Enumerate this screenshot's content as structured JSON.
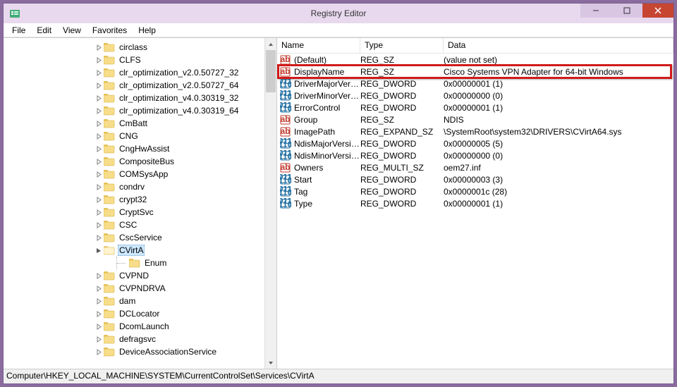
{
  "window": {
    "title": "Registry Editor"
  },
  "menu": {
    "file": "File",
    "edit": "Edit",
    "view": "View",
    "favorites": "Favorites",
    "help": "Help"
  },
  "tree": {
    "items": [
      {
        "label": "circlass",
        "indent": 6
      },
      {
        "label": "CLFS",
        "indent": 6
      },
      {
        "label": "clr_optimization_v2.0.50727_32",
        "indent": 6
      },
      {
        "label": "clr_optimization_v2.0.50727_64",
        "indent": 6
      },
      {
        "label": "clr_optimization_v4.0.30319_32",
        "indent": 6
      },
      {
        "label": "clr_optimization_v4.0.30319_64",
        "indent": 6
      },
      {
        "label": "CmBatt",
        "indent": 6
      },
      {
        "label": "CNG",
        "indent": 6
      },
      {
        "label": "CngHwAssist",
        "indent": 6
      },
      {
        "label": "CompositeBus",
        "indent": 6
      },
      {
        "label": "COMSysApp",
        "indent": 6
      },
      {
        "label": "condrv",
        "indent": 6
      },
      {
        "label": "crypt32",
        "indent": 6
      },
      {
        "label": "CryptSvc",
        "indent": 6
      },
      {
        "label": "CSC",
        "indent": 6
      },
      {
        "label": "CscService",
        "indent": 6
      },
      {
        "label": "CVirtA",
        "indent": 6,
        "selected": true,
        "expanded": true
      },
      {
        "label": "Enum",
        "indent": 7,
        "child": true
      },
      {
        "label": "CVPND",
        "indent": 6
      },
      {
        "label": "CVPNDRVA",
        "indent": 6
      },
      {
        "label": "dam",
        "indent": 6
      },
      {
        "label": "DCLocator",
        "indent": 6
      },
      {
        "label": "DcomLaunch",
        "indent": 6
      },
      {
        "label": "defragsvc",
        "indent": 6
      },
      {
        "label": "DeviceAssociationService",
        "indent": 6
      }
    ]
  },
  "list": {
    "headers": {
      "name": "Name",
      "type": "Type",
      "data": "Data"
    },
    "rows": [
      {
        "icon": "sz",
        "name": "(Default)",
        "type": "REG_SZ",
        "data": "(value not set)"
      },
      {
        "icon": "sz",
        "name": "DisplayName",
        "type": "REG_SZ",
        "data": "Cisco Systems VPN Adapter for 64-bit Windows",
        "highlight": true
      },
      {
        "icon": "bin",
        "name": "DriverMajorVersi...",
        "type": "REG_DWORD",
        "data": "0x00000001 (1)"
      },
      {
        "icon": "bin",
        "name": "DriverMinorVers...",
        "type": "REG_DWORD",
        "data": "0x00000000 (0)"
      },
      {
        "icon": "bin",
        "name": "ErrorControl",
        "type": "REG_DWORD",
        "data": "0x00000001 (1)"
      },
      {
        "icon": "sz",
        "name": "Group",
        "type": "REG_SZ",
        "data": "NDIS"
      },
      {
        "icon": "sz",
        "name": "ImagePath",
        "type": "REG_EXPAND_SZ",
        "data": "\\SystemRoot\\system32\\DRIVERS\\CVirtA64.sys"
      },
      {
        "icon": "bin",
        "name": "NdisMajorVersion",
        "type": "REG_DWORD",
        "data": "0x00000005 (5)"
      },
      {
        "icon": "bin",
        "name": "NdisMinorVersion",
        "type": "REG_DWORD",
        "data": "0x00000000 (0)"
      },
      {
        "icon": "sz",
        "name": "Owners",
        "type": "REG_MULTI_SZ",
        "data": "oem27.inf"
      },
      {
        "icon": "bin",
        "name": "Start",
        "type": "REG_DWORD",
        "data": "0x00000003 (3)"
      },
      {
        "icon": "bin",
        "name": "Tag",
        "type": "REG_DWORD",
        "data": "0x0000001c (28)"
      },
      {
        "icon": "bin",
        "name": "Type",
        "type": "REG_DWORD",
        "data": "0x00000001 (1)"
      }
    ]
  },
  "statusbar": {
    "path": "Computer\\HKEY_LOCAL_MACHINE\\SYSTEM\\CurrentControlSet\\Services\\CVirtA"
  }
}
